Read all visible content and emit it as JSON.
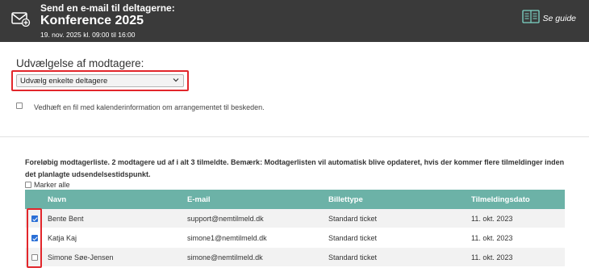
{
  "header": {
    "subtitle": "Send en e-mail til deltagerne:",
    "title": "Konference 2025",
    "date": "19. nov. 2025 kl. 09:00 til 16:00",
    "guide_label": "Se guide",
    "background": "#3a3a3a"
  },
  "recipients": {
    "heading": "Udvælgelse af modtagere:",
    "select_value": "Udvælg enkelte deltagere",
    "attach_label": "Vedhæft en fil med kalenderinformation om arrangementet til beskeden.",
    "attach_checked": false
  },
  "list": {
    "notice": "Foreløbig modtagerliste. 2 modtagere ud af i alt 3 tilmeldte. Bemærk: Modtagerlisten vil automatisk blive opdateret, hvis der kommer flere tilmeldinger inden det planlagte udsendelsestidspunkt.",
    "select_all_label": "Marker alle",
    "columns": [
      "Navn",
      "E-mail",
      "Billettype",
      "Tilmeldingsdato"
    ],
    "header_color": "#6cb2a7",
    "rows": [
      {
        "checked": true,
        "name": "Bente Bent",
        "email": "support@nemtilmeld.dk",
        "ticket": "Standard ticket",
        "date": "11. okt. 2023"
      },
      {
        "checked": true,
        "name": "Katja Kaj",
        "email": "simone1@nemtilmeld.dk",
        "ticket": "Standard ticket",
        "date": "11. okt. 2023"
      },
      {
        "checked": false,
        "name": "Simone Søe-Jensen",
        "email": "simone@nemtilmeld.dk",
        "ticket": "Standard ticket",
        "date": "11. okt. 2023"
      }
    ]
  },
  "highlight_color": "#e2262b"
}
